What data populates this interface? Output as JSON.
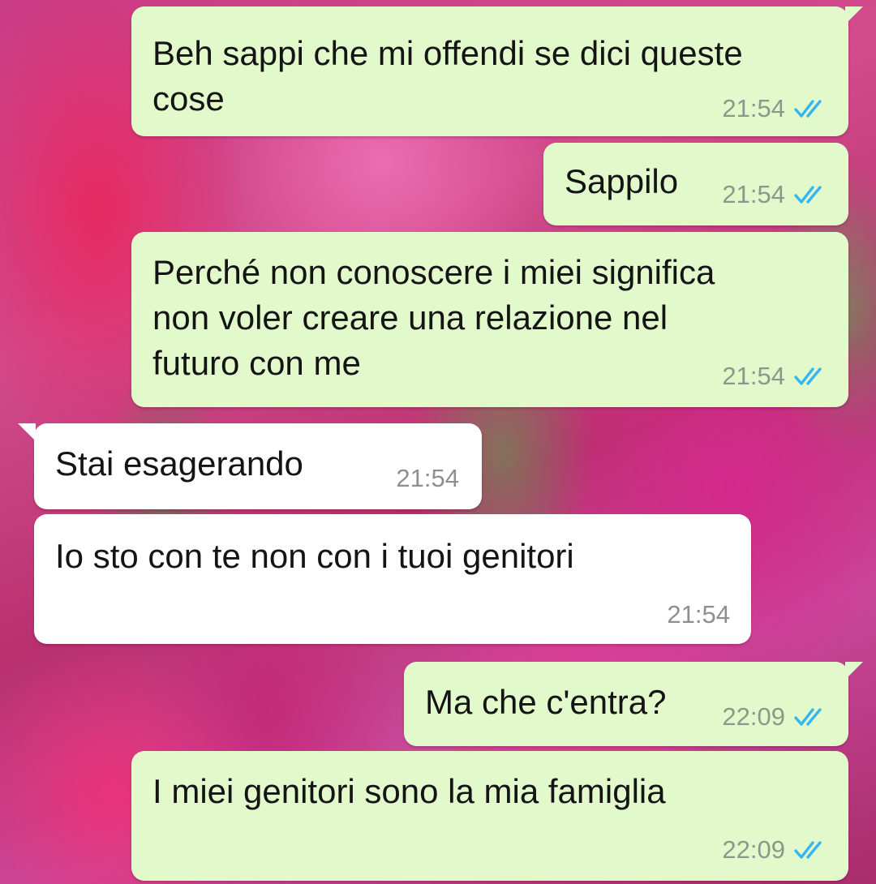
{
  "messages": [
    {
      "direction": "outgoing",
      "text": "Beh sappi che mi offendi se dici queste\ncose",
      "time": "21:54",
      "status_icon": "read-double-check-icon"
    },
    {
      "direction": "outgoing",
      "text": "Sappilo",
      "time": "21:54",
      "status_icon": "read-double-check-icon"
    },
    {
      "direction": "outgoing",
      "text": "Perché non conoscere i miei significa\nnon voler creare una relazione nel\nfuturo con me",
      "time": "21:54",
      "status_icon": "read-double-check-icon"
    },
    {
      "direction": "incoming",
      "text": "Stai esagerando",
      "time": "21:54"
    },
    {
      "direction": "incoming",
      "text": "Io sto con te non con i tuoi genitori",
      "time": "21:54"
    },
    {
      "direction": "outgoing",
      "text": "Ma che c'entra?",
      "time": "22:09",
      "status_icon": "read-double-check-icon"
    },
    {
      "direction": "outgoing",
      "text": "I miei genitori sono la mia famiglia",
      "time": "22:09",
      "status_icon": "read-double-check-icon"
    }
  ],
  "colors": {
    "outgoing_bubble": "#e2f9cc",
    "incoming_bubble": "#ffffff",
    "read_ticks": "#34b7f1",
    "wallpaper": "#c93c86"
  }
}
